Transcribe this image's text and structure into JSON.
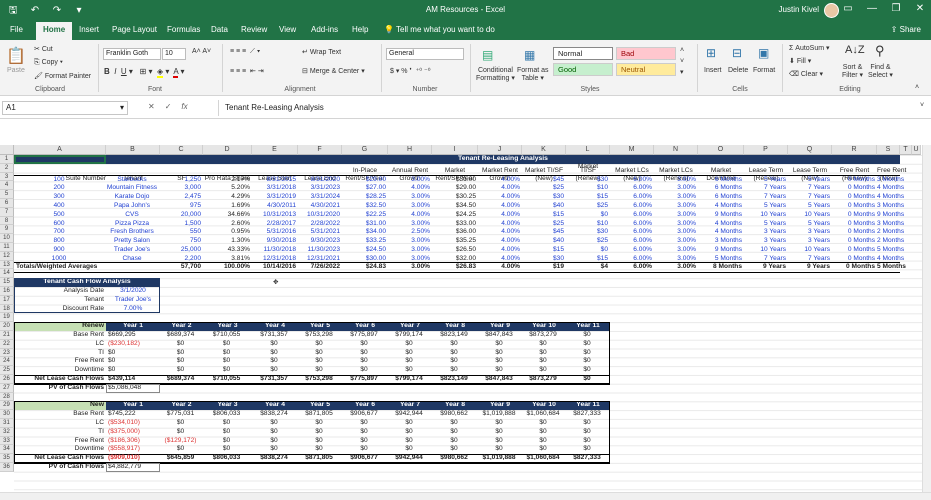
{
  "window": {
    "title": "AM Resources  -  Excel",
    "user": "Justin Kivel"
  },
  "tabs": [
    "File",
    "Home",
    "Insert",
    "Page Layout",
    "Formulas",
    "Data",
    "Review",
    "View",
    "Add-ins",
    "Help"
  ],
  "tellme": "Tell me what you want to do",
  "share": "Share",
  "ribbon": {
    "clipboard": {
      "paste": "Paste",
      "cut": "Cut",
      "copy": "Copy",
      "format_painter": "Format Painter",
      "label": "Clipboard"
    },
    "font": {
      "name": "Franklin Goth",
      "size": "10",
      "label": "Font"
    },
    "alignment": {
      "wrap": "Wrap Text",
      "merge": "Merge & Center",
      "label": "Alignment"
    },
    "number": {
      "format": "General",
      "label": "Number"
    },
    "styles": {
      "conditional": "Conditional",
      "formatting": "Formatting",
      "format_as": "Format as",
      "table": "Table",
      "normal": "Normal",
      "bad": "Bad",
      "good": "Good",
      "neutral": "Neutral",
      "label": "Styles"
    },
    "cells": {
      "insert": "Insert",
      "delete": "Delete",
      "format": "Format",
      "label": "Cells"
    },
    "editing": {
      "autosum": "AutoSum",
      "fill": "Fill",
      "clear": "Clear",
      "sort": "Sort &",
      "filter": "Filter",
      "find": "Find &",
      "select": "Select",
      "label": "Editing"
    }
  },
  "formula_bar": {
    "name_box": "A1",
    "formula": "Tenant Re-Leasing Analysis"
  },
  "columns": [
    "A",
    "B",
    "C",
    "D",
    "E",
    "F",
    "G",
    "H",
    "I",
    "J",
    "K",
    "L",
    "M",
    "N",
    "O",
    "P",
    "Q",
    "R",
    "S",
    "T",
    "U"
  ],
  "rows": [
    "1",
    "2",
    "3",
    "4",
    "5",
    "6",
    "7",
    "8",
    "9",
    "10",
    "11",
    "12",
    "13",
    "14",
    "15",
    "16",
    "17",
    "18",
    "19",
    "20",
    "21",
    "22",
    "23",
    "24",
    "25",
    "26",
    "27",
    "28",
    "29",
    "30",
    "31",
    "32",
    "33",
    "34",
    "35",
    "36"
  ],
  "sheet": {
    "banner": "Tenant Re-Leasing Analysis",
    "headers_top": [
      "",
      "",
      "",
      "",
      "",
      "",
      "",
      "",
      "",
      "",
      "",
      "Market",
      "",
      "",
      "",
      "",
      "",
      "",
      ""
    ],
    "headers_mid": [
      "",
      "",
      "",
      "",
      "",
      "",
      "In-Place",
      "Annual Rent",
      "Market",
      "Market Rent",
      "Market TI/SF",
      "TI/SF",
      "Market LCs",
      "Market LCs",
      "Market",
      "Lease Term",
      "Lease Term",
      "Free Rent",
      "Free Rent"
    ],
    "headers_bot": [
      "Suite Number",
      "Tenant",
      "SF",
      "Pro Rata Share",
      "Lease Start",
      "Lease End",
      "Rent/SF/Year",
      "Growth",
      "Rent/SF/Year",
      "Growth",
      "(New)",
      "(Renew)",
      "(New)",
      "(Renew)",
      "Downtime",
      "(Renew)",
      "(New)",
      "(Renew)",
      "(New)"
    ],
    "tenants": [
      [
        "100",
        "Starbucks",
        "1,250",
        "2.17%",
        "8/31/2015",
        "8/31/2020",
        "$29.00",
        "3.00%",
        "$31.00",
        "4.00%",
        "$45",
        "$30",
        "6.00%",
        "3.00%",
        "6 Months",
        "5 Years",
        "5 Years",
        "0 Months",
        "3 Months"
      ],
      [
        "200",
        "Mountain Fitness",
        "3,000",
        "5.20%",
        "3/31/2018",
        "3/31/2023",
        "$27.00",
        "4.00%",
        "$29.00",
        "4.00%",
        "$25",
        "$10",
        "6.00%",
        "3.00%",
        "6 Months",
        "7 Years",
        "7 Years",
        "0 Months",
        "4 Months"
      ],
      [
        "300",
        "Karate Dojo",
        "2,475",
        "4.29%",
        "3/31/2019",
        "3/31/2024",
        "$28.25",
        "3.00%",
        "$30.25",
        "4.00%",
        "$30",
        "$15",
        "6.00%",
        "3.00%",
        "6 Months",
        "7 Years",
        "7 Years",
        "0 Months",
        "4 Months"
      ],
      [
        "400",
        "Papa John's",
        "975",
        "1.69%",
        "4/30/2011",
        "4/30/2021",
        "$32.50",
        "3.00%",
        "$34.50",
        "4.00%",
        "$40",
        "$25",
        "6.00%",
        "3.00%",
        "4 Months",
        "5 Years",
        "5 Years",
        "0 Months",
        "3 Months"
      ],
      [
        "500",
        "CVS",
        "20,000",
        "34.66%",
        "10/31/2013",
        "10/31/2020",
        "$22.25",
        "4.00%",
        "$24.25",
        "4.00%",
        "$15",
        "$0",
        "6.00%",
        "3.00%",
        "9 Months",
        "10 Years",
        "10 Years",
        "0 Months",
        "9 Months"
      ],
      [
        "600",
        "Pizza Pizza",
        "1,500",
        "2.60%",
        "2/28/2017",
        "2/28/2022",
        "$31.00",
        "3.00%",
        "$33.00",
        "4.00%",
        "$25",
        "$10",
        "6.00%",
        "3.00%",
        "4 Months",
        "5 Years",
        "5 Years",
        "0 Months",
        "3 Months"
      ],
      [
        "700",
        "Fresh Brothers",
        "550",
        "0.95%",
        "5/31/2016",
        "5/31/2021",
        "$34.00",
        "2.50%",
        "$36.00",
        "4.00%",
        "$45",
        "$30",
        "6.00%",
        "3.00%",
        "4 Months",
        "3 Years",
        "3 Years",
        "0 Months",
        "2 Months"
      ],
      [
        "800",
        "Pretty Salon",
        "750",
        "1.30%",
        "9/30/2018",
        "9/30/2023",
        "$33.25",
        "3.00%",
        "$35.25",
        "4.00%",
        "$40",
        "$25",
        "6.00%",
        "3.00%",
        "3 Months",
        "3 Years",
        "3 Years",
        "0 Months",
        "2 Months"
      ],
      [
        "900",
        "Trader Joe's",
        "25,000",
        "43.33%",
        "11/30/2018",
        "11/30/2023",
        "$24.50",
        "3.00%",
        "$26.50",
        "4.00%",
        "$15",
        "$0",
        "6.00%",
        "3.00%",
        "9 Months",
        "10 Years",
        "10 Years",
        "0 Months",
        "5 Months"
      ],
      [
        "1000",
        "Chase",
        "2,200",
        "3.81%",
        "12/31/2018",
        "12/31/2021",
        "$30.00",
        "3.00%",
        "$32.00",
        "4.00%",
        "$30",
        "$15",
        "6.00%",
        "3.00%",
        "5 Months",
        "7 Years",
        "7 Years",
        "0 Months",
        "4 Months"
      ]
    ],
    "totals": [
      "Totals/Weighted Averages",
      "",
      "57,700",
      "100.00%",
      "10/14/2016",
      "7/26/2022",
      "$24.83",
      "3.00%",
      "$26.83",
      "4.00%",
      "$19",
      "$4",
      "6.00%",
      "3.00%",
      "8 Months",
      "9 Years",
      "9 Years",
      "0 Months",
      "5 Months"
    ],
    "cfa": {
      "title": "Tenant Cash Flow Analysis",
      "labels": [
        "Analysis Date",
        "Tenant",
        "Discount Rate"
      ],
      "values": [
        "3/1/2020",
        "Trader Joe's",
        "7.00%"
      ]
    },
    "years": [
      "Year 1",
      "Year 2",
      "Year 3",
      "Year 4",
      "Year 5",
      "Year 6",
      "Year 7",
      "Year 8",
      "Year 9",
      "Year 10",
      "Year 11"
    ],
    "renew": {
      "title": "Renew",
      "rows": [
        {
          "label": "Base Rent",
          "vals": [
            "$669,295",
            "$689,374",
            "$710,055",
            "$731,357",
            "$753,298",
            "$775,897",
            "$799,174",
            "$823,149",
            "$847,843",
            "$873,279",
            "$0"
          ]
        },
        {
          "label": "LC",
          "vals": [
            "($230,182)",
            "$0",
            "$0",
            "$0",
            "$0",
            "$0",
            "$0",
            "$0",
            "$0",
            "$0",
            "$0"
          ]
        },
        {
          "label": "TI",
          "vals": [
            "$0",
            "$0",
            "$0",
            "$0",
            "$0",
            "$0",
            "$0",
            "$0",
            "$0",
            "$0",
            "$0"
          ]
        },
        {
          "label": "Free Rent",
          "vals": [
            "$0",
            "$0",
            "$0",
            "$0",
            "$0",
            "$0",
            "$0",
            "$0",
            "$0",
            "$0",
            "$0"
          ]
        },
        {
          "label": "Downtime",
          "vals": [
            "$0",
            "$0",
            "$0",
            "$0",
            "$0",
            "$0",
            "$0",
            "$0",
            "$0",
            "$0",
            "$0"
          ]
        }
      ],
      "net_label": "Net Lease Cash Flows",
      "net": [
        "$439,114",
        "$689,374",
        "$710,055",
        "$731,357",
        "$753,298",
        "$775,897",
        "$799,174",
        "$823,149",
        "$847,843",
        "$873,279",
        "$0"
      ],
      "pv_label": "PV of Cash Flows",
      "pv": "$5,086,048"
    },
    "newl": {
      "title": "New",
      "rows": [
        {
          "label": "Base Rent",
          "vals": [
            "$745,222",
            "$775,031",
            "$806,033",
            "$838,274",
            "$871,805",
            "$906,677",
            "$942,944",
            "$980,662",
            "$1,019,888",
            "$1,060,684",
            "$827,333"
          ]
        },
        {
          "label": "LC",
          "vals": [
            "($534,010)",
            "$0",
            "$0",
            "$0",
            "$0",
            "$0",
            "$0",
            "$0",
            "$0",
            "$0",
            "$0"
          ]
        },
        {
          "label": "TI",
          "vals": [
            "($375,000)",
            "$0",
            "$0",
            "$0",
            "$0",
            "$0",
            "$0",
            "$0",
            "$0",
            "$0",
            "$0"
          ]
        },
        {
          "label": "Free Rent",
          "vals": [
            "($186,306)",
            "($129,172)",
            "$0",
            "$0",
            "$0",
            "$0",
            "$0",
            "$0",
            "$0",
            "$0",
            "$0"
          ]
        },
        {
          "label": "Downtime",
          "vals": [
            "($558,917)",
            "$0",
            "$0",
            "$0",
            "$0",
            "$0",
            "$0",
            "$0",
            "$0",
            "$0",
            "$0"
          ]
        }
      ],
      "net_label": "Net Lease Cash Flows",
      "net": [
        "($909,010)",
        "$645,859",
        "$806,033",
        "$838,274",
        "$871,805",
        "$906,677",
        "$942,944",
        "$980,662",
        "$1,019,888",
        "$1,060,684",
        "$827,333"
      ],
      "pv_label": "PV of Cash Flows",
      "pv": "$4,882,779"
    }
  }
}
